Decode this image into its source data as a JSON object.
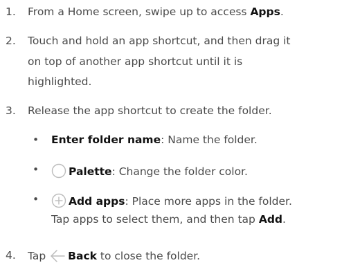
{
  "steps": [
    {
      "num": "1.",
      "text": "From a Home screen, swipe up to access ",
      "bold": "Apps",
      "end": "."
    },
    {
      "num": "2.",
      "lines": [
        "Touch and hold an app shortcut, and then drag it",
        "on top of another app shortcut until it is",
        "highlighted."
      ]
    },
    {
      "num": "3.",
      "text": "Release the app shortcut to create the folder."
    },
    {
      "num": "4.",
      "pre": "Tap ",
      "icon": "back-arrow-icon",
      "bold": "Back",
      "post": " to close the folder."
    }
  ],
  "bullets": [
    {
      "bullet": "•",
      "bold": "Enter folder name",
      "text": ": Name the folder."
    },
    {
      "bullet": "•",
      "icon": "palette-circle-icon",
      "bold": "Palette",
      "text": ": Change the folder color."
    },
    {
      "bullet": "•",
      "icon": "add-circle-icon",
      "bold": "Add apps",
      "text": ": Place more apps in the folder.",
      "line2_pre": "Tap apps to select them, and then tap ",
      "line2_bold": "Add",
      "line2_end": "."
    }
  ],
  "colors": {
    "text": "#4a4a4a",
    "bold": "#111111",
    "icon": "#bcbcbc"
  }
}
